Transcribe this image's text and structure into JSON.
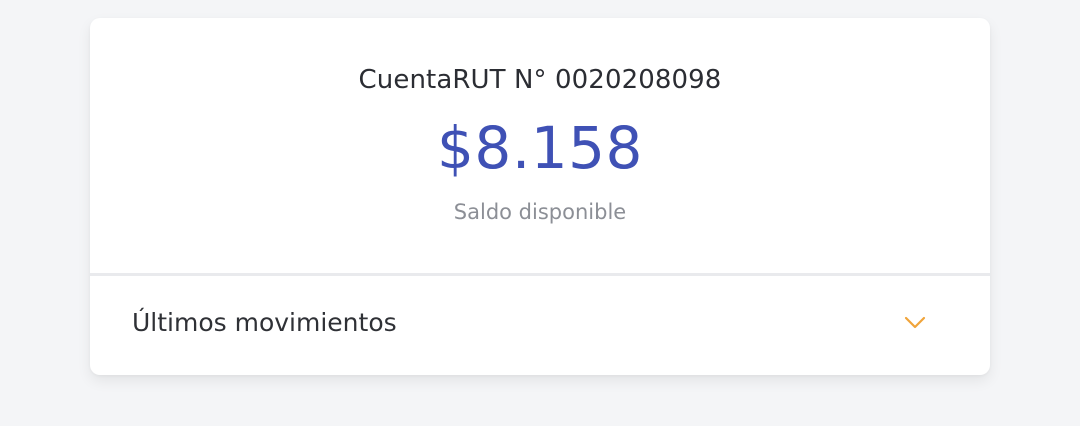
{
  "account": {
    "title": "CuentaRUT N° 0020208098",
    "balance": "$8.158",
    "balance_label": "Saldo disponible"
  },
  "movements": {
    "label": "Últimos movimientos",
    "toggle_icon": "chevron-down-icon"
  },
  "colors": {
    "accent": "#3f51b5",
    "chevron": "#f0a43a",
    "background": "#f4f5f7"
  }
}
